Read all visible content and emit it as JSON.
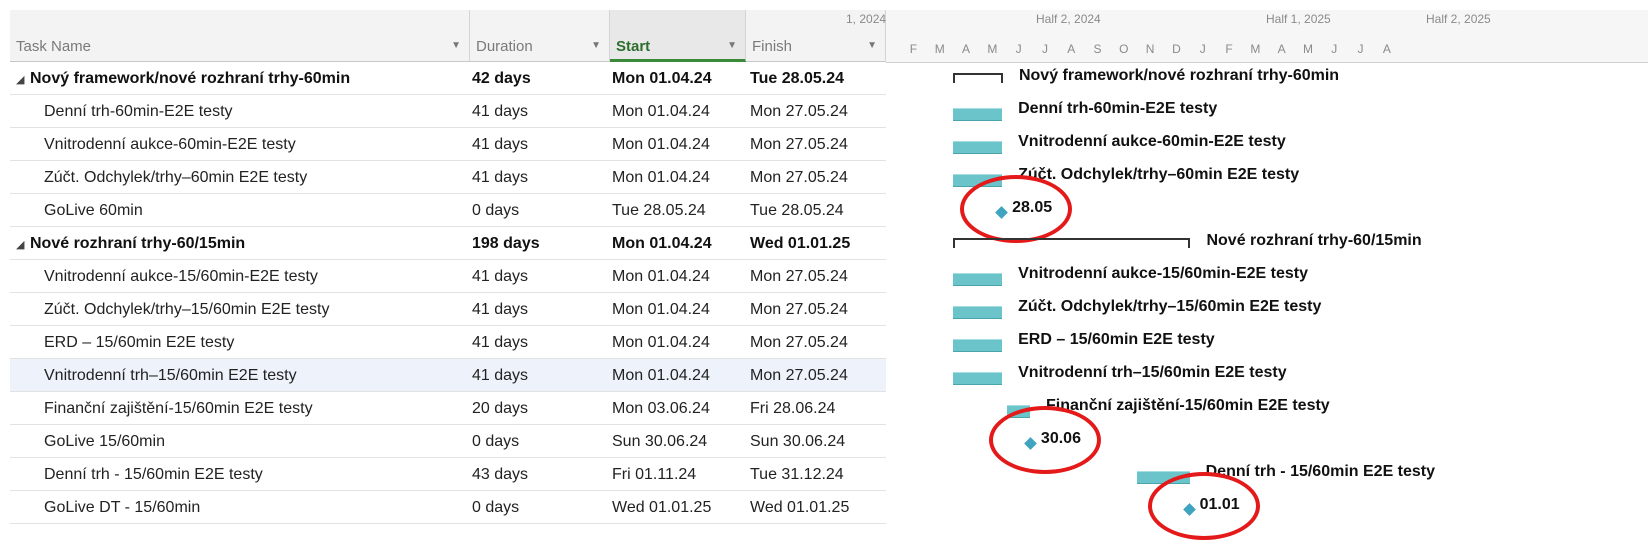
{
  "headers": {
    "task_name": "Task Name",
    "duration": "Duration",
    "start": "Start",
    "finish": "Finish"
  },
  "timescale": {
    "tier1": [
      "1, 2024",
      "Half 2, 2024",
      "Half 1, 2025",
      "Half 2, 2025"
    ],
    "tier2": [
      "F",
      "M",
      "A",
      "M",
      "J",
      "J",
      "A",
      "S",
      "O",
      "N",
      "D",
      "J",
      "F",
      "M",
      "A",
      "M",
      "J",
      "J",
      "A"
    ]
  },
  "tasks": [
    {
      "name": "Nový framework/nové rozhraní trhy-60min",
      "duration": "42 days",
      "start": "Mon 01.04.24",
      "finish": "Tue 28.05.24",
      "summary": true
    },
    {
      "name": "Denní trh-60min-E2E testy",
      "duration": "41 days",
      "start": "Mon 01.04.24",
      "finish": "Mon 27.05.24"
    },
    {
      "name": "Vnitrodenní aukce-60min-E2E testy",
      "duration": "41 days",
      "start": "Mon 01.04.24",
      "finish": "Mon 27.05.24"
    },
    {
      "name": "Zúčt. Odchylek/trhy–60min E2E testy",
      "duration": "41 days",
      "start": "Mon 01.04.24",
      "finish": "Mon 27.05.24"
    },
    {
      "name": "GoLive 60min",
      "duration": "0 days",
      "start": "Tue 28.05.24",
      "finish": "Tue 28.05.24",
      "milestone": true
    },
    {
      "name": "Nové rozhraní trhy-60/15min",
      "duration": "198 days",
      "start": "Mon 01.04.24",
      "finish": "Wed 01.01.25",
      "summary": true
    },
    {
      "name": "Vnitrodenní aukce-15/60min-E2E testy",
      "duration": "41 days",
      "start": "Mon 01.04.24",
      "finish": "Mon 27.05.24"
    },
    {
      "name": "Zúčt. Odchylek/trhy–15/60min E2E testy",
      "duration": "41 days",
      "start": "Mon 01.04.24",
      "finish": "Mon 27.05.24"
    },
    {
      "name": "ERD – 15/60min E2E testy",
      "duration": "41 days",
      "start": "Mon 01.04.24",
      "finish": "Mon 27.05.24"
    },
    {
      "name": "Vnitrodenní trh–15/60min E2E testy",
      "duration": "41 days",
      "start": "Mon 01.04.24",
      "finish": "Mon 27.05.24",
      "selected": true
    },
    {
      "name": "Finanční zajištění-15/60min E2E testy",
      "duration": "20 days",
      "start": "Mon 03.06.24",
      "finish": "Fri 28.06.24"
    },
    {
      "name": "GoLive 15/60min",
      "duration": "0 days",
      "start": "Sun 30.06.24",
      "finish": "Sun 30.06.24",
      "milestone": true
    },
    {
      "name": "Denní trh - 15/60min E2E testy",
      "duration": "43 days",
      "start": "Fri 01.11.24",
      "finish": "Tue 31.12.24"
    },
    {
      "name": "GoLive DT - 15/60min",
      "duration": "0 days",
      "start": "Wed 01.01.25",
      "finish": "Wed 01.01.25",
      "milestone": true
    }
  ],
  "gantt": {
    "labels": [
      "Nový framework/nové rozhraní trhy-60min",
      "Denní trh-60min-E2E testy",
      "Vnitrodenní aukce-60min-E2E testy",
      "Zúčt. Odchylek/trhy–60min E2E testy",
      "28.05",
      "Nové rozhraní trhy-60/15min",
      "Vnitrodenní aukce-15/60min-E2E testy",
      "Zúčt. Odchylek/trhy–15/60min E2E testy",
      "ERD – 15/60min E2E testy",
      "Vnitrodenní trh–15/60min E2E testy",
      "Finanční zajištění-15/60min E2E testy",
      "30.06",
      "Denní trh - 15/60min E2E testy",
      "01.01"
    ]
  },
  "colors": {
    "bar": "#6cc4cb",
    "milestone": "#3ea4c0",
    "annotation": "#e41a1a",
    "start_header_accent": "#3a8a3a"
  }
}
